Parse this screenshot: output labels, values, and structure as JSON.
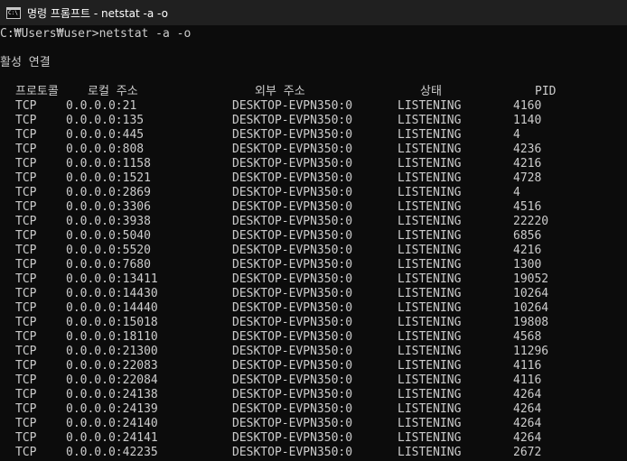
{
  "window": {
    "title": "명령 프롬프트 - netstat  -a -o"
  },
  "console": {
    "prompt": "C:₩Users₩user>netstat -a -o",
    "heading": "활성 연결",
    "headers": {
      "proto": "프로토콜",
      "local": "로컬 주소",
      "foreign": "외부 주소",
      "state": "상태",
      "pid": "PID"
    },
    "rows": [
      {
        "proto": "TCP",
        "local": "0.0.0.0:21",
        "foreign": "DESKTOP-EVPN350:0",
        "state": "LISTENING",
        "pid": "4160"
      },
      {
        "proto": "TCP",
        "local": "0.0.0.0:135",
        "foreign": "DESKTOP-EVPN350:0",
        "state": "LISTENING",
        "pid": "1140"
      },
      {
        "proto": "TCP",
        "local": "0.0.0.0:445",
        "foreign": "DESKTOP-EVPN350:0",
        "state": "LISTENING",
        "pid": "4"
      },
      {
        "proto": "TCP",
        "local": "0.0.0.0:808",
        "foreign": "DESKTOP-EVPN350:0",
        "state": "LISTENING",
        "pid": "4236"
      },
      {
        "proto": "TCP",
        "local": "0.0.0.0:1158",
        "foreign": "DESKTOP-EVPN350:0",
        "state": "LISTENING",
        "pid": "4216"
      },
      {
        "proto": "TCP",
        "local": "0.0.0.0:1521",
        "foreign": "DESKTOP-EVPN350:0",
        "state": "LISTENING",
        "pid": "4728"
      },
      {
        "proto": "TCP",
        "local": "0.0.0.0:2869",
        "foreign": "DESKTOP-EVPN350:0",
        "state": "LISTENING",
        "pid": "4"
      },
      {
        "proto": "TCP",
        "local": "0.0.0.0:3306",
        "foreign": "DESKTOP-EVPN350:0",
        "state": "LISTENING",
        "pid": "4516"
      },
      {
        "proto": "TCP",
        "local": "0.0.0.0:3938",
        "foreign": "DESKTOP-EVPN350:0",
        "state": "LISTENING",
        "pid": "22220"
      },
      {
        "proto": "TCP",
        "local": "0.0.0.0:5040",
        "foreign": "DESKTOP-EVPN350:0",
        "state": "LISTENING",
        "pid": "6856"
      },
      {
        "proto": "TCP",
        "local": "0.0.0.0:5520",
        "foreign": "DESKTOP-EVPN350:0",
        "state": "LISTENING",
        "pid": "4216"
      },
      {
        "proto": "TCP",
        "local": "0.0.0.0:7680",
        "foreign": "DESKTOP-EVPN350:0",
        "state": "LISTENING",
        "pid": "1300"
      },
      {
        "proto": "TCP",
        "local": "0.0.0.0:13411",
        "foreign": "DESKTOP-EVPN350:0",
        "state": "LISTENING",
        "pid": "19052"
      },
      {
        "proto": "TCP",
        "local": "0.0.0.0:14430",
        "foreign": "DESKTOP-EVPN350:0",
        "state": "LISTENING",
        "pid": "10264"
      },
      {
        "proto": "TCP",
        "local": "0.0.0.0:14440",
        "foreign": "DESKTOP-EVPN350:0",
        "state": "LISTENING",
        "pid": "10264"
      },
      {
        "proto": "TCP",
        "local": "0.0.0.0:15018",
        "foreign": "DESKTOP-EVPN350:0",
        "state": "LISTENING",
        "pid": "19808"
      },
      {
        "proto": "TCP",
        "local": "0.0.0.0:18110",
        "foreign": "DESKTOP-EVPN350:0",
        "state": "LISTENING",
        "pid": "4568"
      },
      {
        "proto": "TCP",
        "local": "0.0.0.0:21300",
        "foreign": "DESKTOP-EVPN350:0",
        "state": "LISTENING",
        "pid": "11296"
      },
      {
        "proto": "TCP",
        "local": "0.0.0.0:22083",
        "foreign": "DESKTOP-EVPN350:0",
        "state": "LISTENING",
        "pid": "4116"
      },
      {
        "proto": "TCP",
        "local": "0.0.0.0:22084",
        "foreign": "DESKTOP-EVPN350:0",
        "state": "LISTENING",
        "pid": "4116"
      },
      {
        "proto": "TCP",
        "local": "0.0.0.0:24138",
        "foreign": "DESKTOP-EVPN350:0",
        "state": "LISTENING",
        "pid": "4264"
      },
      {
        "proto": "TCP",
        "local": "0.0.0.0:24139",
        "foreign": "DESKTOP-EVPN350:0",
        "state": "LISTENING",
        "pid": "4264"
      },
      {
        "proto": "TCP",
        "local": "0.0.0.0:24140",
        "foreign": "DESKTOP-EVPN350:0",
        "state": "LISTENING",
        "pid": "4264"
      },
      {
        "proto": "TCP",
        "local": "0.0.0.0:24141",
        "foreign": "DESKTOP-EVPN350:0",
        "state": "LISTENING",
        "pid": "4264"
      },
      {
        "proto": "TCP",
        "local": "0.0.0.0:42235",
        "foreign": "DESKTOP-EVPN350:0",
        "state": "LISTENING",
        "pid": "2672"
      }
    ]
  },
  "icons": {
    "app": "cmd-icon"
  },
  "colors": {
    "background": "#0c0c0c",
    "titlebar": "#202020",
    "text": "#cccccc"
  }
}
